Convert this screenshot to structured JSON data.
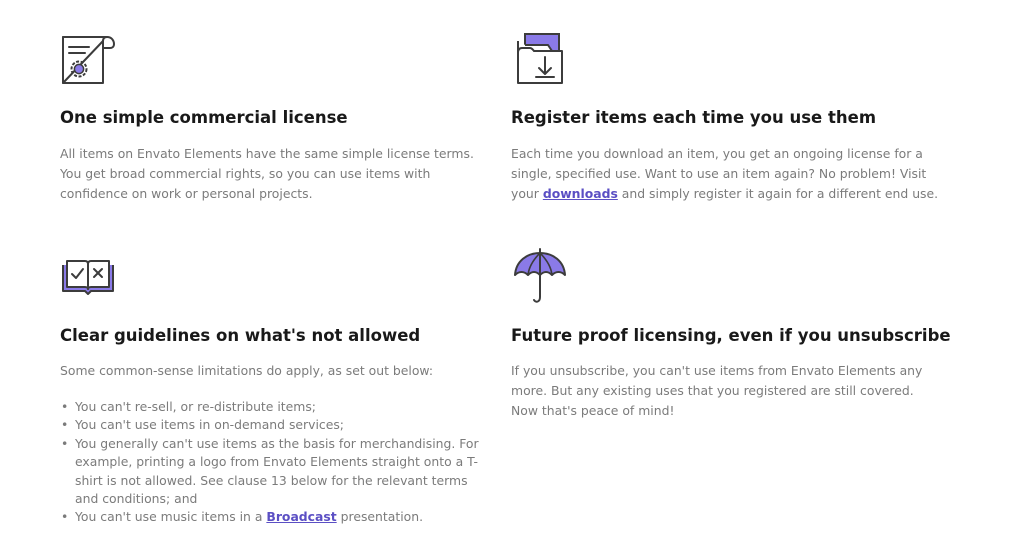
{
  "features": {
    "license": {
      "title": "One simple commercial license",
      "body": "All items on Envato Elements have the same simple license terms. You get broad commercial rights, so you can use items with confidence on work or personal projects."
    },
    "register": {
      "title": "Register items each time you use them",
      "body_before": "Each time you download an item, you get an ongoing license for a single, specified use. Want to use an item again? No problem! Visit your",
      "link": "downloads",
      "body_after": "and simply register it again for a different end use."
    },
    "guidelines": {
      "title": "Clear guidelines on what's not allowed",
      "intro": "Some common-sense limitations do apply, as set out below:",
      "items": [
        "You can't re-sell, or re-distribute items;",
        "You can't use items in on-demand services;",
        "You generally can't use items as the basis for merchandising. For example, printing a logo from Envato Elements straight onto a T-shirt is not allowed. See clause 13 below for the relevant terms and conditions; and"
      ],
      "last_before": "You can't use music items in a",
      "last_link": "Broadcast",
      "last_after": "presentation."
    },
    "future": {
      "title": "Future proof licensing, even if you unsubscribe",
      "body": "If you unsubscribe, you can't use items from Envato Elements any more. But any existing uses that you registered are still covered. Now that's peace of mind!"
    }
  },
  "icons": {
    "license": "license-document-gear-icon",
    "register": "download-folder-icon",
    "guidelines": "open-book-check-cross-icon",
    "future": "umbrella-icon"
  },
  "colors": {
    "accent": "#8a7ae8",
    "link": "#5b4fc4",
    "heading": "#191919",
    "body_text": "#7b7b7b",
    "icon_stroke": "#3c3c3c"
  }
}
